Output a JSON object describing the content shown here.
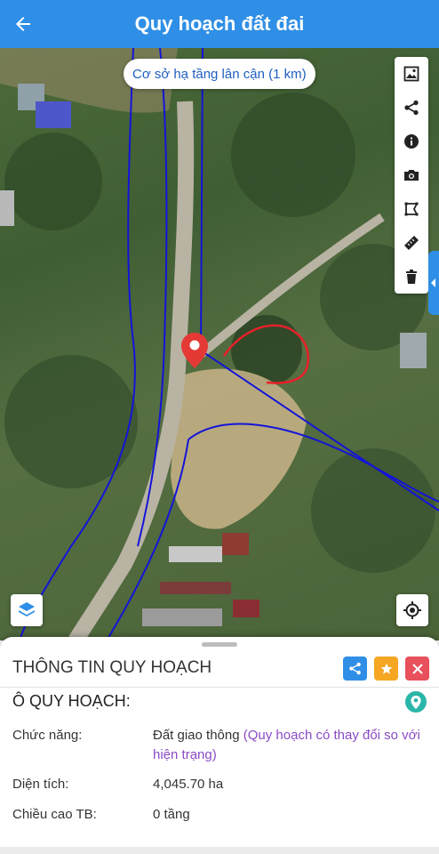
{
  "header": {
    "title": "Quy hoạch đất đai"
  },
  "map": {
    "nearby_chip": "Cơ sở hạ tầng lân cận (1 km)"
  },
  "toolbar": {
    "items": [
      "image-icon",
      "share-icon",
      "info-icon",
      "camera-icon",
      "polygon-icon",
      "ruler-icon",
      "trash-icon"
    ]
  },
  "panel": {
    "title": "THÔNG TIN QUY HOẠCH",
    "section_title": "Ô QUY HOẠCH:",
    "fields": [
      {
        "label": "Chức năng:",
        "value": "Đất giao thông",
        "note": "(Quy hoạch có thay đổi so với hiện trạng)"
      },
      {
        "label": "Diện tích:",
        "value": "4,045.70 ha"
      },
      {
        "label": "Chiều cao TB:",
        "value": "0 tầng"
      }
    ]
  },
  "colors": {
    "accent": "#2f8fe6",
    "star": "#f5a623",
    "close": "#e8505b",
    "pin": "#e53935",
    "boundary": "#1414d8",
    "annotation": "#e8202a",
    "note": "#8b4bc4"
  }
}
